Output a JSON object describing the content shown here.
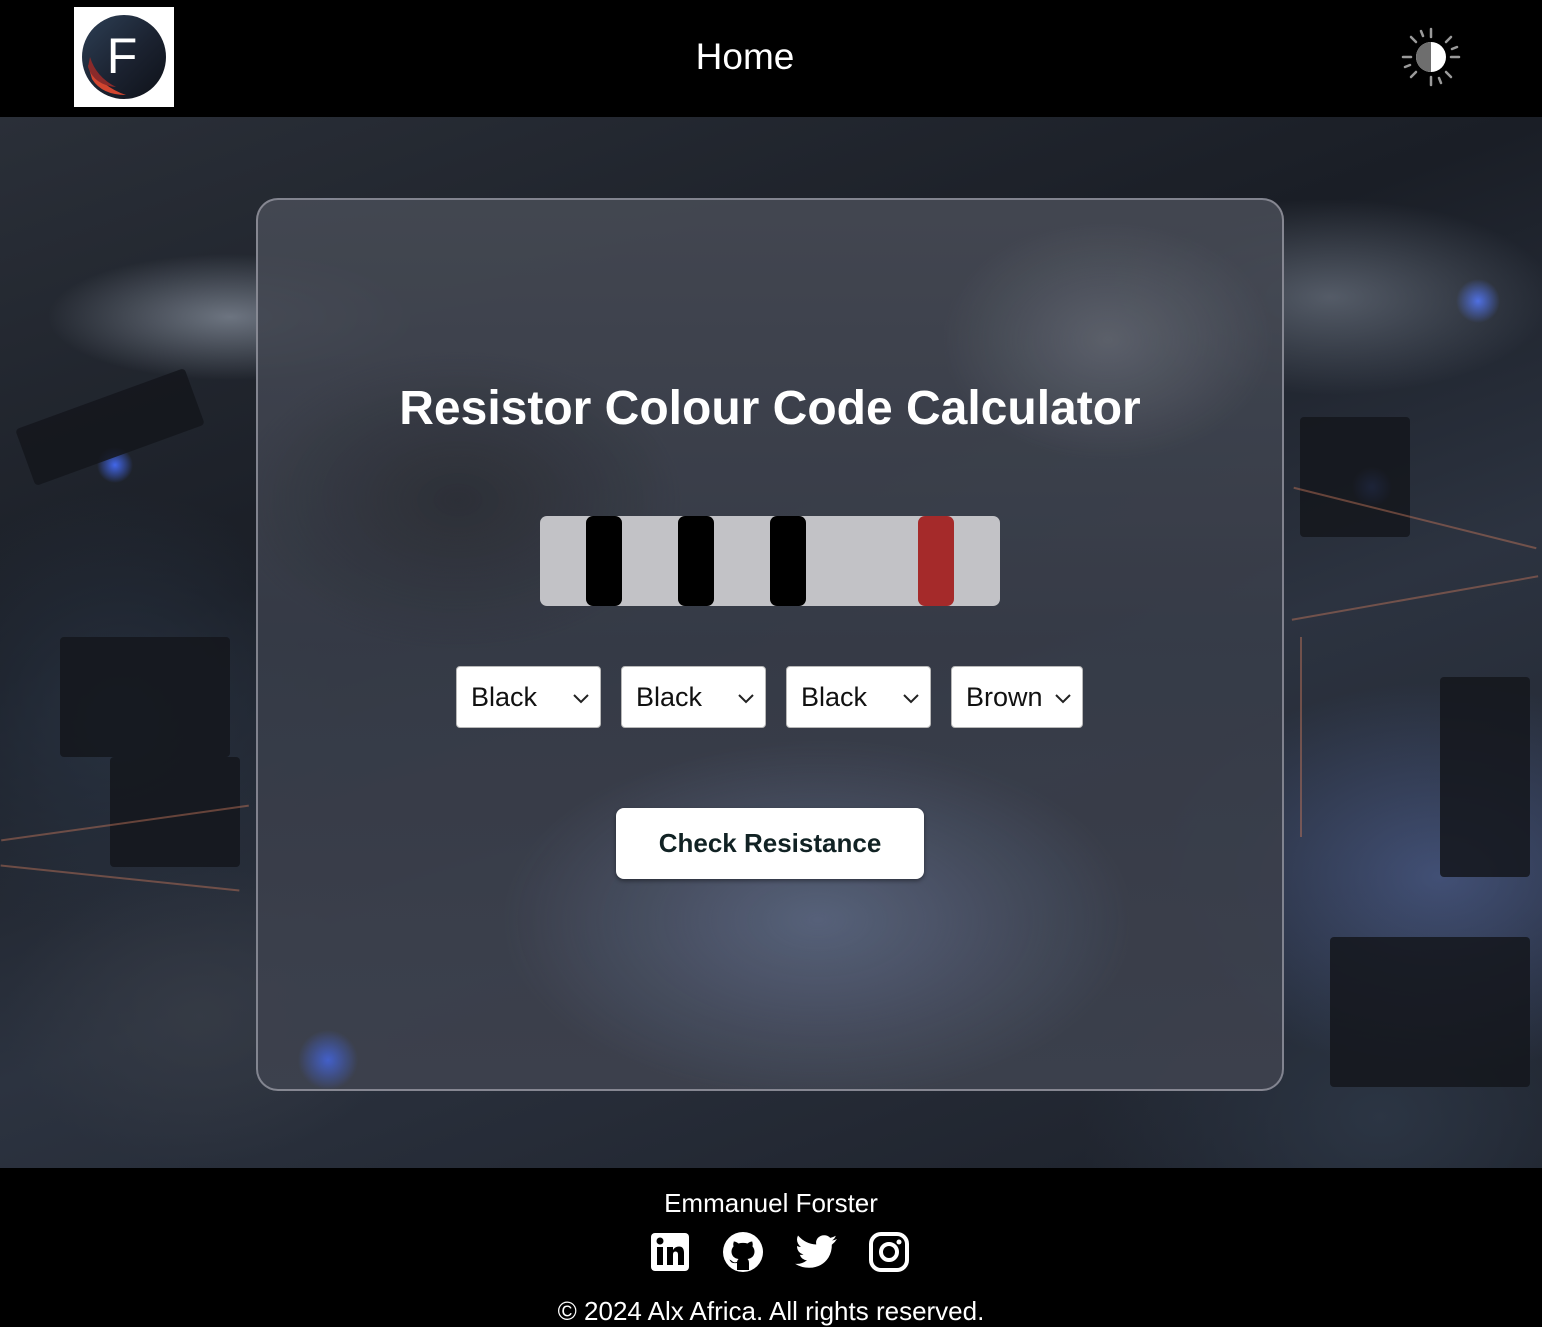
{
  "header": {
    "logo_letter": "F",
    "nav_home": "Home",
    "theme_toggle_icon": "contrast-icon"
  },
  "calculator": {
    "title": "Resistor Colour Code Calculator",
    "bands": [
      {
        "color": "#000000"
      },
      {
        "color": "#000000"
      },
      {
        "color": "#000000"
      },
      {
        "color": "#a52a2a"
      }
    ],
    "selects": [
      {
        "value": "Black"
      },
      {
        "value": "Black"
      },
      {
        "value": "Black"
      },
      {
        "value": "Brown"
      }
    ],
    "check_button": "Check Resistance"
  },
  "footer": {
    "author": "Emmanuel Forster",
    "social_icons": [
      "linkedin-icon",
      "github-icon",
      "twitter-icon",
      "instagram-icon"
    ],
    "copyright": "© 2024 Alx Africa. All rights reserved."
  },
  "colors": {
    "header_bg": "#000000",
    "card_border": "#bebec8",
    "resistor_body": "#c2c2c6",
    "button_text": "#112224"
  }
}
